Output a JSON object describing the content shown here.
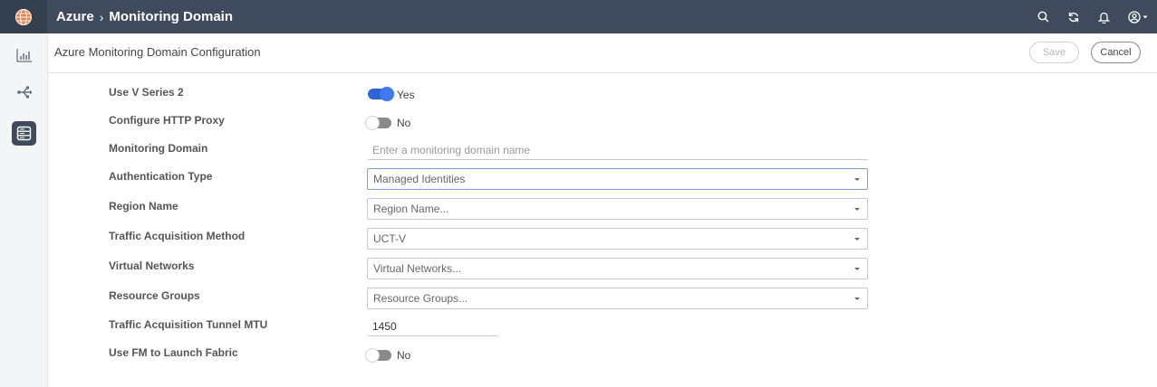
{
  "topbar": {
    "breadcrumb_parent": "Azure",
    "breadcrumb_separator": "›",
    "breadcrumb_current": "Monitoring Domain",
    "icons": [
      "globe-logo-icon",
      "search-icon",
      "refresh-icon",
      "bell-icon",
      "user-icon"
    ]
  },
  "sidebar": {
    "items": [
      {
        "name": "chart-icon",
        "active": false
      },
      {
        "name": "share-icon",
        "active": false
      },
      {
        "name": "server-icon",
        "active": true
      }
    ]
  },
  "header": {
    "title": "Azure Monitoring Domain Configuration",
    "save_label": "Save",
    "cancel_label": "Cancel"
  },
  "form": {
    "use_v_series_2": {
      "label": "Use V Series 2",
      "value": "Yes"
    },
    "configure_http_proxy": {
      "label": "Configure HTTP Proxy",
      "value": "No"
    },
    "monitoring_domain": {
      "label": "Monitoring Domain",
      "placeholder": "Enter a monitoring domain name",
      "value": ""
    },
    "authentication_type": {
      "label": "Authentication Type",
      "value": "Managed Identities"
    },
    "region_name": {
      "label": "Region Name",
      "value": "Region Name..."
    },
    "traffic_acquisition_method": {
      "label": "Traffic Acquisition Method",
      "value": "UCT-V"
    },
    "virtual_networks": {
      "label": "Virtual Networks",
      "value": "Virtual Networks..."
    },
    "resource_groups": {
      "label": "Resource Groups",
      "value": "Resource Groups..."
    },
    "tunnel_mtu": {
      "label": "Traffic Acquisition Tunnel MTU",
      "value": "1450"
    },
    "use_fm_launch_fabric": {
      "label": "Use FM to Launch Fabric",
      "value": "No"
    }
  },
  "colors": {
    "topbar": "#3f4b5c",
    "accent": "#2f64d9"
  }
}
